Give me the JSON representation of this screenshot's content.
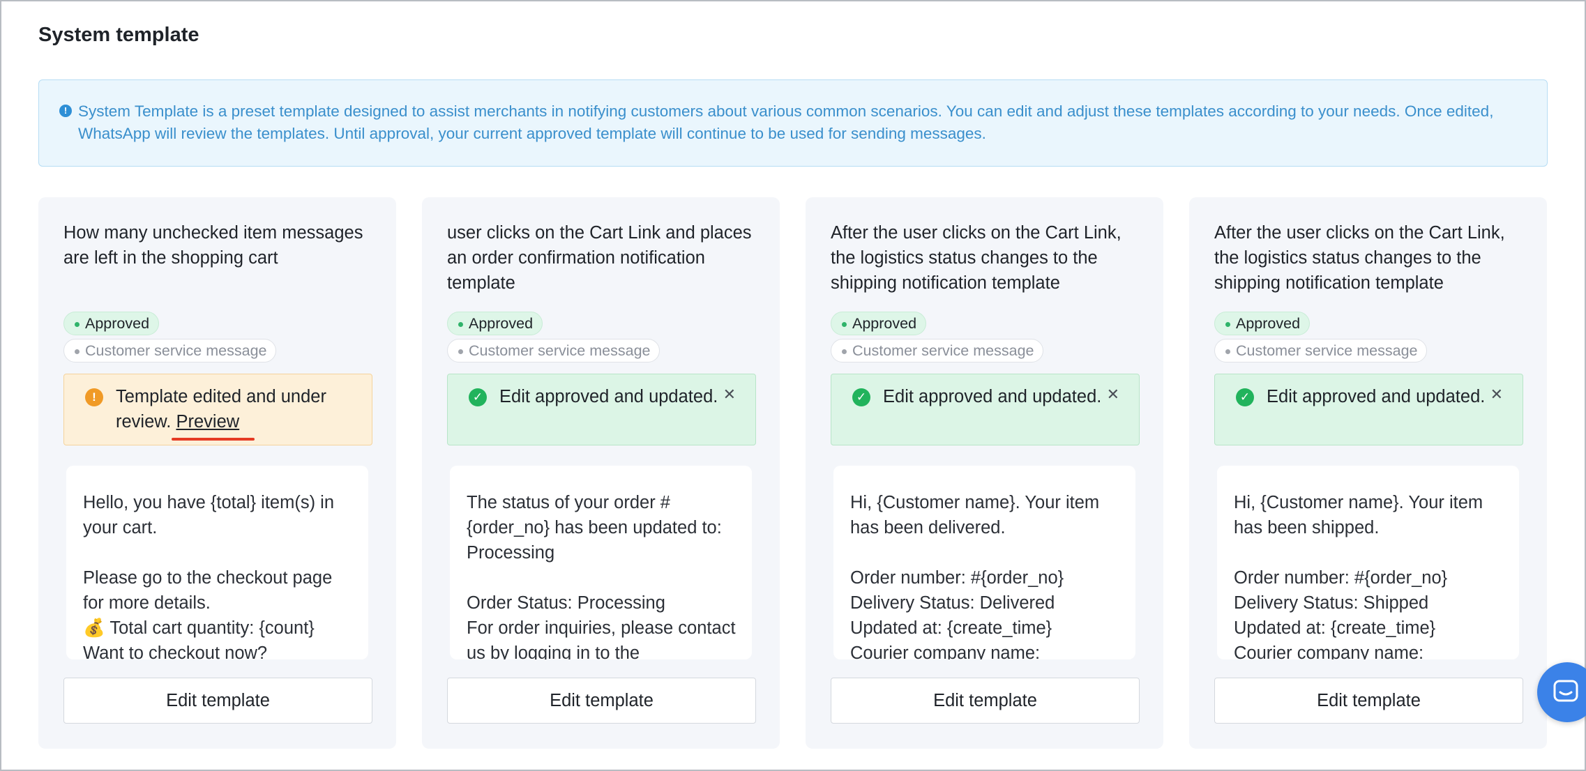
{
  "page": {
    "title": "System template",
    "notice": "System Template is a preset template designed to assist merchants in notifying customers about various common scenarios. You can edit and adjust these templates according to your needs. Once edited, WhatsApp will review the templates. Until approval, your current approved template will continue to be used for sending messages."
  },
  "cards": [
    {
      "title": "How many unchecked item messages are left in the shopping cart",
      "tag_status": "Approved",
      "tag_type": "Customer service message",
      "status_text": "Template edited and under review.",
      "status_link": "Preview",
      "body": "Hello, you have {total} item(s) in your cart.\n\nPlease go to the checkout page for more details.\n💰 Total cart quantity: {count}\nWant to checkout now?",
      "button": "Edit template"
    },
    {
      "title": "user clicks on the Cart Link and places an order confirmation notification template",
      "tag_status": "Approved",
      "tag_type": "Customer service message",
      "status_text": "Edit approved and updated.",
      "body": "The status of your order #{order_no} has been updated to: Processing\n\nOrder Status: Processing\nFor order inquiries, please contact us by logging in to the",
      "button": "Edit template"
    },
    {
      "title": "After the user clicks on the Cart Link, the logistics status changes to the shipping notification template",
      "tag_status": "Approved",
      "tag_type": "Customer service message",
      "status_text": "Edit approved and updated.",
      "body": "Hi, {Customer name}. Your item has been delivered.\n\nOrder number: #{order_no}\nDelivery Status: Delivered\nUpdated at: {create_time}\nCourier company name:",
      "button": "Edit template"
    },
    {
      "title": "After the user clicks on the Cart Link, the logistics status changes to the shipping notification template",
      "tag_status": "Approved",
      "tag_type": "Customer service message",
      "status_text": "Edit approved and updated.",
      "body": "Hi, {Customer name}. Your item has been shipped.\n\nOrder number: #{order_no}\nDelivery Status: Shipped\nUpdated at: {create_time}\nCourier company name:",
      "button": "Edit template"
    }
  ],
  "icons": {
    "info": "info-icon",
    "warning": "warning-icon",
    "success": "check-circle-icon",
    "close": "close-icon",
    "chat": "chat-icon"
  },
  "colors": {
    "notice_text": "#3a8fcc",
    "approved_tag": "#def6e8",
    "review_banner": "#fdf0d9",
    "success_banner": "#dcf5e6",
    "preview_underline": "#e53a23",
    "chat_button": "#3b82e8"
  }
}
